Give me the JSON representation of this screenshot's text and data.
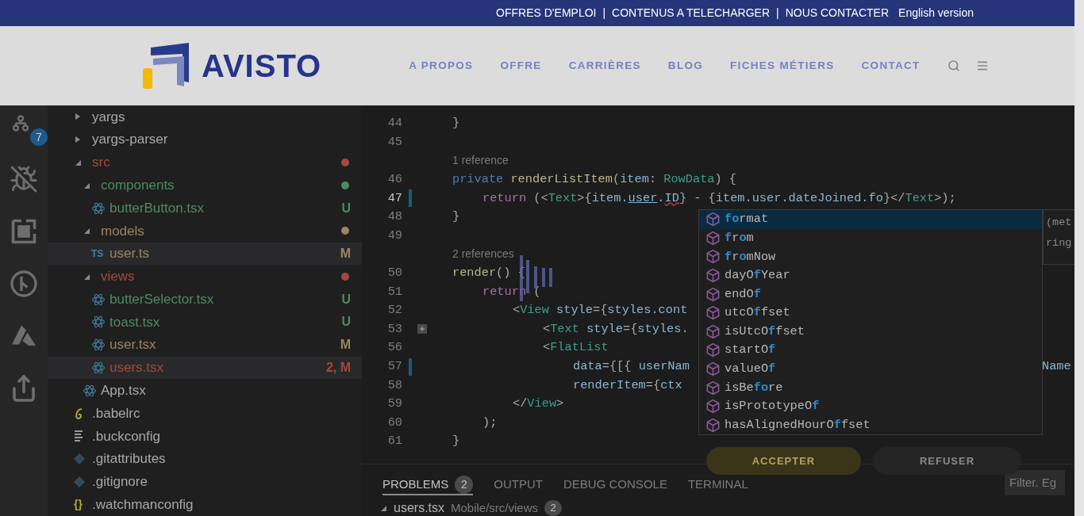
{
  "top_bar": {
    "links": [
      {
        "kind": "link",
        "label": "OFFRES D'EMPLOI"
      },
      {
        "kind": "separator",
        "label": "|"
      },
      {
        "kind": "link",
        "label": "CONTENUS A TELECHARGER"
      },
      {
        "kind": "separator",
        "label": "|"
      },
      {
        "kind": "link",
        "label": "NOUS CONTACTER"
      },
      {
        "kind": "link",
        "label": "English version"
      }
    ]
  },
  "header": {
    "logo_text": "AVISTO",
    "nav": [
      "A PROPOS",
      "OFFRE",
      "CARRIÈRES",
      "BLOG",
      "FICHES MÉTIERS",
      "CONTACT"
    ]
  },
  "activity_bar": [
    {
      "kind": "source-control",
      "badge": "7"
    },
    {
      "kind": "bug-off"
    },
    {
      "kind": "extensions"
    },
    {
      "kind": "git-circle"
    },
    {
      "kind": "azure"
    },
    {
      "kind": "live-share"
    }
  ],
  "explorer": {
    "items": [
      {
        "kind": "folder",
        "name": "yargs",
        "expanded": false,
        "highlighted": false
      },
      {
        "kind": "folder",
        "name": "yargs-parser",
        "expanded": false,
        "highlighted": false
      },
      {
        "kind": "folder",
        "name": "src",
        "expanded": true,
        "color": "#a5493d",
        "highlighted": false,
        "children": [
          {
            "kind": "folder",
            "name": "components",
            "expanded": true,
            "color": "#4f8a63",
            "highlighted": false,
            "children": [
              {
                "kind": "react",
                "name": "butterButton.tsx",
                "color": "#4f8a63",
                "badge": "U",
                "highlighted": false
              }
            ]
          },
          {
            "kind": "folder",
            "name": "models",
            "expanded": true,
            "color": "#9a8560",
            "highlighted": false,
            "children": [
              {
                "kind": "ts",
                "icon_text": "TS",
                "name": "user.ts",
                "color": "#9a8560",
                "badge": "M",
                "highlighted": true
              }
            ]
          },
          {
            "kind": "folder",
            "name": "views",
            "expanded": true,
            "color": "#a5493d",
            "highlighted": false,
            "children": [
              {
                "kind": "react",
                "name": "butterSelector.tsx",
                "color": "#4f8a63",
                "badge": "U",
                "highlighted": false
              },
              {
                "kind": "react",
                "name": "toast.tsx",
                "color": "#4f8a63",
                "badge": "U",
                "highlighted": false
              },
              {
                "kind": "react",
                "name": "user.tsx",
                "color": "#9a8560",
                "badge": "M",
                "highlighted": false
              },
              {
                "kind": "react",
                "name": "users.tsx",
                "color": "#a5493d",
                "badge": "2, M",
                "highlighted": true
              }
            ]
          },
          {
            "kind": "react",
            "name": "App.tsx",
            "highlighted": false
          }
        ]
      },
      {
        "kind": "babel",
        "name": ".babelrc",
        "highlighted": false
      },
      {
        "kind": "lines",
        "name": ".buckconfig",
        "highlighted": false
      },
      {
        "kind": "git",
        "name": ".gitattributes",
        "highlighted": false
      },
      {
        "kind": "git",
        "name": ".gitignore",
        "highlighted": false
      },
      {
        "kind": "json",
        "icon_text": "{}",
        "name": ".watchmanconfig",
        "highlighted": false
      }
    ]
  },
  "editor": {
    "lines": [
      {
        "kind": "code",
        "number": "44",
        "segments": [
          {
            "kind": "punc",
            "text": "}"
          }
        ]
      },
      {
        "kind": "code",
        "number": "45"
      },
      {
        "kind": "codelens",
        "text": "1 reference"
      },
      {
        "kind": "code",
        "number": "46",
        "segments": [
          {
            "kind": "kw",
            "text": "private"
          },
          {
            "kind": "fn",
            "text": " renderListItem"
          },
          {
            "kind": "punc",
            "text": "("
          },
          {
            "kind": "var",
            "text": "item"
          },
          {
            "kind": "punc",
            "text": ": "
          },
          {
            "kind": "type",
            "text": "RowData"
          },
          {
            "kind": "punc",
            "text": ") {"
          }
        ],
        "children": [
          {
            "kind": "code",
            "number": "47",
            "current": true,
            "modified": true,
            "segments": [
              {
                "kind": "ctrl",
                "text": "return"
              },
              {
                "kind": "punc",
                "text": " (<"
              },
              {
                "kind": "tag",
                "text": "Text"
              },
              {
                "kind": "punc",
                "text": ">{"
              },
              {
                "kind": "var",
                "text": "item."
              },
              {
                "kind": "link",
                "text": "user"
              },
              {
                "kind": "var",
                "text": "."
              },
              {
                "kind": "error",
                "text": "ID"
              },
              {
                "kind": "punc",
                "text": "} - {"
              },
              {
                "kind": "var",
                "text": "item.user.dateJoined.fo"
              },
              {
                "kind": "punc",
                "text": "}</"
              },
              {
                "kind": "tag",
                "text": "Text"
              },
              {
                "kind": "punc",
                "text": ">);"
              }
            ]
          }
        ]
      },
      {
        "kind": "code",
        "number": "48",
        "segments": [
          {
            "kind": "punc",
            "text": "}"
          }
        ]
      },
      {
        "kind": "code",
        "number": "49"
      },
      {
        "kind": "codelens",
        "text": "2 references"
      },
      {
        "kind": "code",
        "number": "50",
        "segments": [
          {
            "kind": "fn",
            "text": "render"
          },
          {
            "kind": "punc",
            "text": "() {"
          }
        ],
        "children": [
          {
            "kind": "code",
            "number": "51",
            "segments": [
              {
                "kind": "ctrl",
                "text": "return"
              },
              {
                "kind": "punc",
                "text": " ("
              }
            ],
            "children": [
              {
                "kind": "code",
                "number": "52",
                "segments": [
                  {
                    "kind": "punc",
                    "text": "<"
                  },
                  {
                    "kind": "tag",
                    "text": "View"
                  },
                  {
                    "kind": "var",
                    "text": " style"
                  },
                  {
                    "kind": "punc",
                    "text": "={"
                  },
                  {
                    "kind": "var",
                    "text": "styles.cont"
                  }
                ],
                "children": [
                  {
                    "kind": "code",
                    "number": "53",
                    "folded": true,
                    "segments": [
                      {
                        "kind": "punc",
                        "text": "<"
                      },
                      {
                        "kind": "tag",
                        "text": "Text"
                      },
                      {
                        "kind": "var",
                        "text": " style"
                      },
                      {
                        "kind": "punc",
                        "text": "={"
                      },
                      {
                        "kind": "var",
                        "text": "styles."
                      }
                    ]
                  },
                  {
                    "kind": "code",
                    "number": "56",
                    "segments": [
                      {
                        "kind": "punc",
                        "text": "<"
                      },
                      {
                        "kind": "tag",
                        "text": "FlatList"
                      }
                    ],
                    "children": [
                      {
                        "kind": "code",
                        "number": "57",
                        "modified": true,
                        "segments": [
                          {
                            "kind": "var",
                            "text": "data"
                          },
                          {
                            "kind": "punc",
                            "text": "={[{ "
                          },
                          {
                            "kind": "var",
                            "text": "userNam"
                          }
                        ],
                        "trailing_text": "Name"
                      },
                      {
                        "kind": "code",
                        "number": "58",
                        "segments": [
                          {
                            "kind": "var",
                            "text": "renderItem"
                          },
                          {
                            "kind": "punc",
                            "text": "={"
                          },
                          {
                            "kind": "var",
                            "text": "ctx"
                          }
                        ]
                      }
                    ]
                  }
                ]
              },
              {
                "kind": "code",
                "number": "59",
                "segments": [
                  {
                    "kind": "punc",
                    "text": "</"
                  },
                  {
                    "kind": "tag",
                    "text": "View"
                  },
                  {
                    "kind": "punc",
                    "text": ">"
                  }
                ]
              }
            ]
          },
          {
            "kind": "code",
            "number": "60",
            "segments": [
              {
                "kind": "punc",
                "text": ");"
              }
            ]
          }
        ]
      },
      {
        "kind": "code",
        "number": "61",
        "segments": [
          {
            "kind": "punc",
            "text": "}"
          }
        ]
      }
    ],
    "suggestions": [
      {
        "selected": true,
        "parts": [
          {
            "text": "fo",
            "match": true
          },
          {
            "text": "rmat",
            "match": false
          }
        ]
      },
      {
        "selected": false,
        "parts": [
          {
            "text": "f",
            "match": true
          },
          {
            "text": "r",
            "match": false
          },
          {
            "text": "o",
            "match": true
          },
          {
            "text": "m",
            "match": false
          }
        ]
      },
      {
        "selected": false,
        "parts": [
          {
            "text": "f",
            "match": true
          },
          {
            "text": "r",
            "match": false
          },
          {
            "text": "o",
            "match": true
          },
          {
            "text": "mNow",
            "match": false
          }
        ]
      },
      {
        "selected": false,
        "parts": [
          {
            "text": "dayO",
            "match": false
          },
          {
            "text": "f",
            "match": true
          },
          {
            "text": "Year",
            "match": false
          }
        ]
      },
      {
        "selected": false,
        "parts": [
          {
            "text": "endO",
            "match": false
          },
          {
            "text": "f",
            "match": true
          }
        ]
      },
      {
        "selected": false,
        "parts": [
          {
            "text": "utcO",
            "match": false
          },
          {
            "text": "f",
            "match": true
          },
          {
            "text": "fset",
            "match": false
          }
        ]
      },
      {
        "selected": false,
        "parts": [
          {
            "text": "isUtcO",
            "match": false
          },
          {
            "text": "f",
            "match": true
          },
          {
            "text": "fset",
            "match": false
          }
        ]
      },
      {
        "selected": false,
        "parts": [
          {
            "text": "startO",
            "match": false
          },
          {
            "text": "f",
            "match": true
          }
        ]
      },
      {
        "selected": false,
        "parts": [
          {
            "text": "valueO",
            "match": false
          },
          {
            "text": "f",
            "match": true
          }
        ]
      },
      {
        "selected": false,
        "parts": [
          {
            "text": "isBe",
            "match": false
          },
          {
            "text": "fo",
            "match": true
          },
          {
            "text": "re",
            "match": false
          }
        ]
      },
      {
        "selected": false,
        "parts": [
          {
            "text": "isPrototypeO",
            "match": false
          },
          {
            "text": "f",
            "match": true
          }
        ]
      },
      {
        "selected": false,
        "parts": [
          {
            "text": "hasAlignedHourO",
            "match": false
          },
          {
            "text": "f",
            "match": true
          },
          {
            "text": "fset",
            "match": false
          }
        ]
      }
    ],
    "suggestion_detail": [
      "(met",
      "ring"
    ]
  },
  "panel": {
    "tabs": [
      {
        "label": "PROBLEMS",
        "badge": "2",
        "selected": true
      },
      {
        "label": "OUTPUT",
        "selected": false
      },
      {
        "label": "DEBUG CONSOLE",
        "selected": false
      },
      {
        "label": "TERMINAL",
        "selected": false
      }
    ],
    "filter_placeholder": "Filter. Eg",
    "problem_file": {
      "expanded": true,
      "name": "users.tsx",
      "path": "Mobile/src/views",
      "count": "2"
    }
  },
  "cookie_banner": {
    "buttons": [
      {
        "kind": "accept",
        "label": "ACCEPTER"
      },
      {
        "kind": "decline",
        "label": "REFUSER"
      }
    ]
  }
}
